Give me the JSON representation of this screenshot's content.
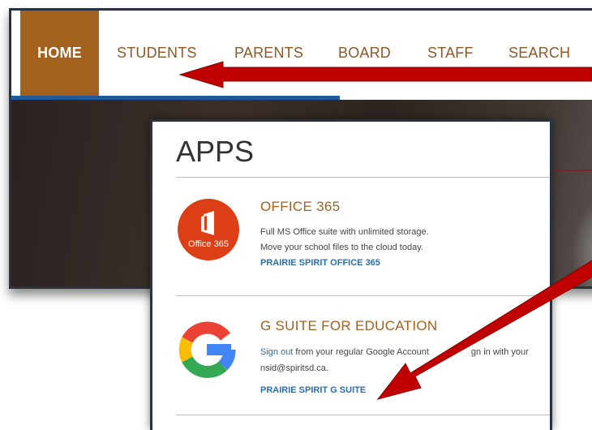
{
  "nav": {
    "items": [
      {
        "label": "HOME"
      },
      {
        "label": "STUDENTS"
      },
      {
        "label": "PARENTS"
      },
      {
        "label": "BOARD"
      },
      {
        "label": "STAFF"
      },
      {
        "label": "SEARCH"
      }
    ],
    "active": "HOME"
  },
  "apps": {
    "title": "APPS",
    "office": {
      "name": "OFFICE 365",
      "logo_text": "Office 365",
      "desc_line1": "Full MS Office suite with unlimited storage.",
      "desc_line2": "Move your school files to the cloud today.",
      "link": "PRAIRIE SPIRIT OFFICE 365"
    },
    "gsuite": {
      "name": "G SUITE FOR EDUCATION",
      "signout": "Sign out",
      "desc_rest": " from your regular Google Account",
      "desc_tail": "gn in with your",
      "desc_line2": "nsid@spiritsd.ca.",
      "link": "PRAIRIE SPIRIT G SUITE"
    }
  },
  "colors": {
    "accent": "#a2611d",
    "link": "#2a6db0",
    "office_red": "#dc3e15",
    "arrow_red": "#c00000"
  },
  "icons": [
    "office-365-logo-icon",
    "google-g-logo-icon",
    "red-arrow-icon"
  ]
}
